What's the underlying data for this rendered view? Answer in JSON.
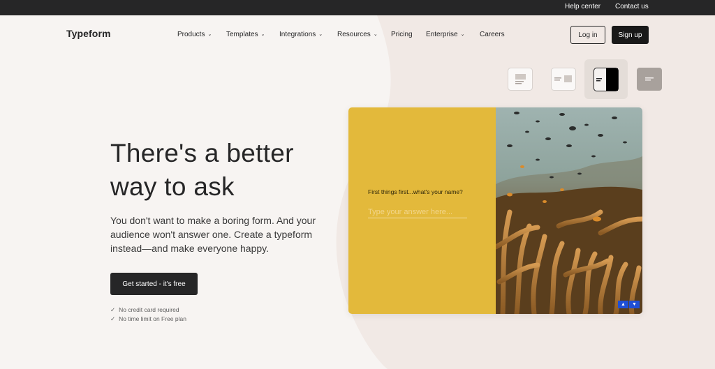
{
  "topbar": {
    "help": "Help center",
    "contact": "Contact us"
  },
  "header": {
    "logo": "Typeform",
    "nav": [
      "Products",
      "Templates",
      "Integrations",
      "Resources",
      "Pricing",
      "Enterprise",
      "Careers"
    ],
    "nav_dropdown": [
      true,
      true,
      true,
      true,
      false,
      true,
      false
    ],
    "login": "Log in",
    "signup": "Sign up"
  },
  "hero": {
    "title": "There's a better way to ask",
    "subtitle": "You don't want to make a boring form. And your audience won't answer one. Create a typeform instead—and make everyone happy.",
    "cta": "Get started - it's free",
    "checks": [
      "No credit card required",
      "No time limit on Free plan"
    ],
    "check_glyph": "✓"
  },
  "layout_switcher": {
    "options": [
      "layout-stack-icon",
      "layout-split-small-icon",
      "layout-split-icon",
      "layout-wallpaper-icon"
    ],
    "selected_index": 2
  },
  "preview": {
    "question": "First things first...what's your name?",
    "placeholder": "Type your answer here...",
    "accent": "#e3b93b",
    "nav_up": "▲",
    "nav_down": "▼"
  },
  "colors": {
    "dark": "#262627",
    "background": "#f7f4f2",
    "shape": "#efe8e3",
    "nav_button": "#1f4fd6"
  }
}
